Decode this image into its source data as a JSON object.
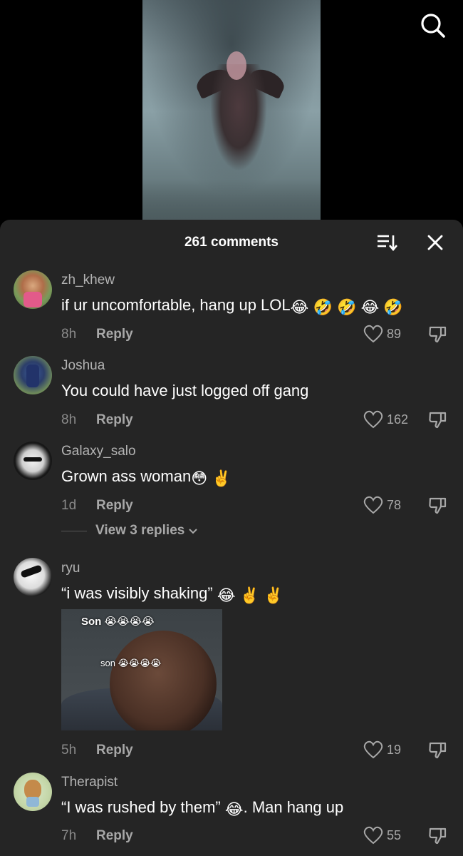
{
  "header": {
    "title": "261 comments"
  },
  "icons": {
    "search": "search-icon",
    "sort": "sort-icon",
    "close": "close-icon",
    "like": "heart-icon",
    "dislike": "dislike-icon"
  },
  "comments": [
    {
      "username": "zh_khew",
      "text": "if ur uncomfortable, hang up LOL",
      "emojis": [
        "😂",
        "🤣",
        "🤣",
        "😂",
        "🤣"
      ],
      "time": "8h",
      "reply_label": "Reply",
      "likes": "89"
    },
    {
      "username": "Joshua",
      "text": "You could have just logged off gang",
      "emojis": [],
      "time": "8h",
      "reply_label": "Reply",
      "likes": "162"
    },
    {
      "username": "Galaxy_salo",
      "text": "Grown ass woman",
      "emojis": [
        "😳",
        "✌️"
      ],
      "time": "1d",
      "reply_label": "Reply",
      "likes": "78",
      "view_replies": "View 3 replies"
    },
    {
      "username": "ryu",
      "text": "“i was visibly shaking”",
      "emojis": [
        "😂",
        "✌️",
        "✌️"
      ],
      "image_caption_top": "Son 😭😭😭😭",
      "image_caption_mid": "son 😭😭😭😭",
      "time": "5h",
      "reply_label": "Reply",
      "likes": "19"
    },
    {
      "username": "Therapist",
      "text_before": "“I was rushed by them” ",
      "emoji_inline": "😂",
      "text_after": ". Man hang up",
      "time": "7h",
      "reply_label": "Reply",
      "likes": "55"
    }
  ]
}
